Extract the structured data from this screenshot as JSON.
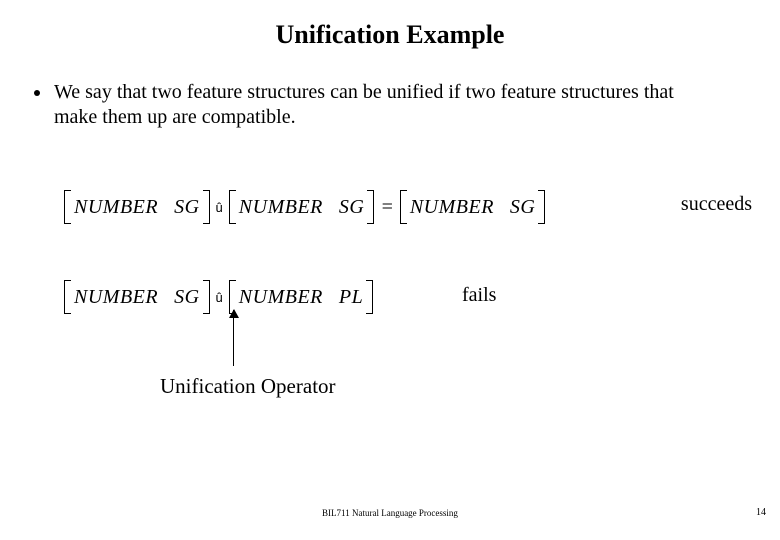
{
  "title": "Unification Example",
  "bullet_text": "We say that two feature structures can be unified if two feature structures that make them up are compatible.",
  "eq1": {
    "left": {
      "attr": "NUMBER",
      "val": "SG"
    },
    "right": {
      "attr": "NUMBER",
      "val": "SG"
    },
    "result": {
      "attr": "NUMBER",
      "val": "SG"
    },
    "op_glyph": "û",
    "equals": "=",
    "status": "succeeds"
  },
  "eq2": {
    "left": {
      "attr": "NUMBER",
      "val": "SG"
    },
    "right": {
      "attr": "NUMBER",
      "val": "PL"
    },
    "op_glyph": "û",
    "status": "fails"
  },
  "operator_label": "Unification Operator",
  "footer": "BIL711 Natural Language Processing",
  "page_number": "14"
}
